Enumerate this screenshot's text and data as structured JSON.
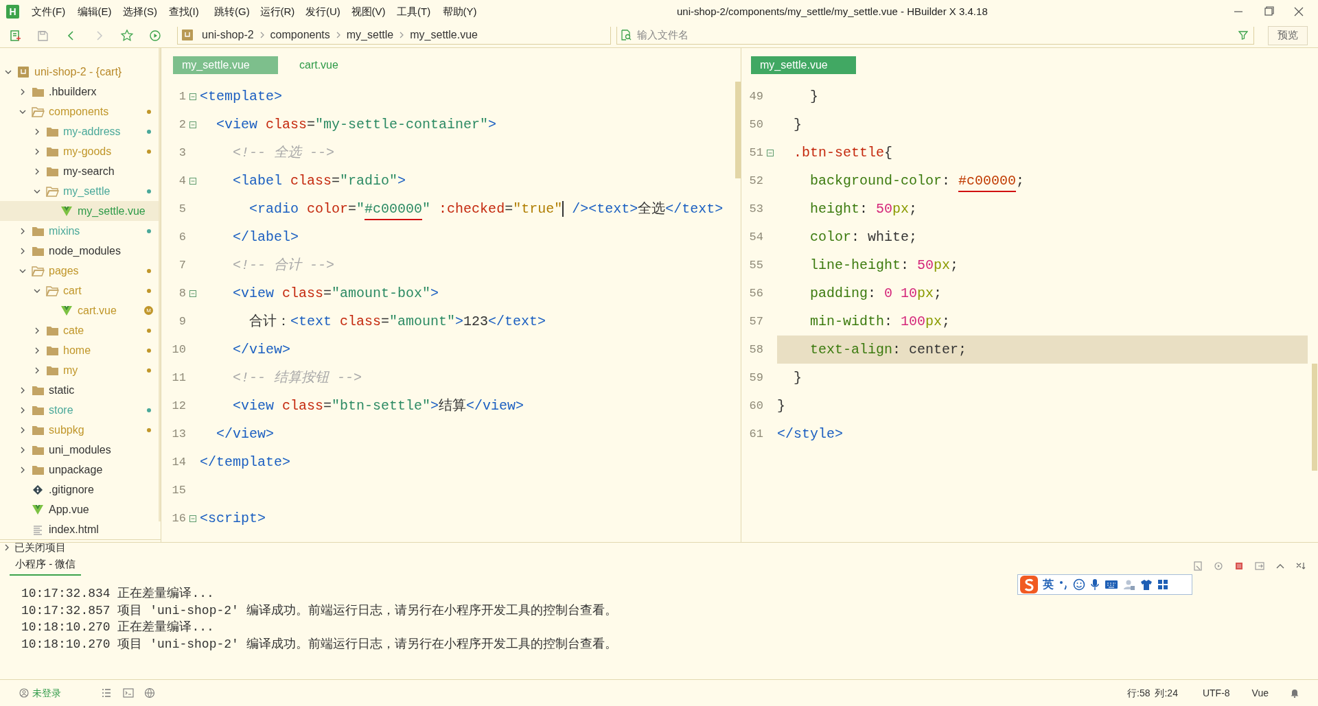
{
  "window": {
    "logo": "H",
    "title": "uni-shop-2/components/my_settle/my_settle.vue - HBuilder X 3.4.18"
  },
  "menu": [
    "文件(F)",
    "编辑(E)",
    "选择(S)",
    "查找(I)",
    "跳转(G)",
    "运行(R)",
    "发行(U)",
    "视图(V)",
    "工具(T)",
    "帮助(Y)"
  ],
  "toolbar": {
    "breadcrumb": [
      "uni-shop-2",
      "components",
      "my_settle",
      "my_settle.vue"
    ],
    "search": {
      "placeholder": "输入文件名"
    },
    "preview_button": "预览"
  },
  "sidebar": {
    "tree": [
      {
        "label": "uni-shop-2 - {cart}",
        "kind": "project",
        "expanded": true,
        "selected": false,
        "children": [
          {
            "label": ".hbuilderx",
            "kind": "folder",
            "expanded": false,
            "selected": false
          },
          {
            "label": "components",
            "kind": "folder",
            "expanded": true,
            "selected": false,
            "color": "#c0962a",
            "children": [
              {
                "label": "my-address",
                "kind": "folder",
                "expanded": false,
                "selected": false,
                "color": "#4aa89a"
              },
              {
                "label": "my-goods",
                "kind": "folder",
                "expanded": false,
                "selected": false,
                "color": "#c0962a"
              },
              {
                "label": "my-search",
                "kind": "folder",
                "expanded": false,
                "selected": false
              },
              {
                "label": "my_settle",
                "kind": "folder",
                "expanded": true,
                "selected": false,
                "color": "#4aa89a",
                "children": [
                  {
                    "label": "my_settle.vue",
                    "kind": "vue",
                    "selected": true
                  }
                ]
              }
            ]
          },
          {
            "label": "mixins",
            "kind": "folder",
            "expanded": false,
            "selected": false,
            "color": "#4aa89a"
          },
          {
            "label": "node_modules",
            "kind": "folder",
            "expanded": false,
            "selected": false
          },
          {
            "label": "pages",
            "kind": "folder",
            "expanded": true,
            "selected": false,
            "color": "#c0962a",
            "children": [
              {
                "label": "cart",
                "kind": "folder",
                "expanded": true,
                "selected": false,
                "color": "#c0962a",
                "children": [
                  {
                    "label": "cart.vue",
                    "kind": "vue",
                    "selected": false,
                    "color": "#c0962a",
                    "badge": "M"
                  }
                ]
              },
              {
                "label": "cate",
                "kind": "folder",
                "expanded": false,
                "selected": false,
                "color": "#c0962a"
              },
              {
                "label": "home",
                "kind": "folder",
                "expanded": false,
                "selected": false,
                "color": "#c0962a"
              },
              {
                "label": "my",
                "kind": "folder",
                "expanded": false,
                "selected": false,
                "color": "#c0962a"
              }
            ]
          },
          {
            "label": "static",
            "kind": "folder",
            "expanded": false,
            "selected": false
          },
          {
            "label": "store",
            "kind": "folder",
            "expanded": false,
            "selected": false,
            "color": "#4aa89a"
          },
          {
            "label": "subpkg",
            "kind": "folder",
            "expanded": false,
            "selected": false,
            "color": "#c0962a"
          },
          {
            "label": "uni_modules",
            "kind": "folder",
            "expanded": false,
            "selected": false
          },
          {
            "label": "unpackage",
            "kind": "folder",
            "expanded": false,
            "selected": false
          },
          {
            "label": ".gitignore",
            "kind": "git",
            "selected": false
          },
          {
            "label": "App.vue",
            "kind": "vue",
            "selected": false
          },
          {
            "label": "index.html",
            "kind": "file",
            "selected": false
          }
        ]
      }
    ],
    "closed_projects": "已关闭项目"
  },
  "editors": [
    {
      "tabs": [
        {
          "label": "my_settle.vue",
          "selected": true
        },
        {
          "label": "cart.vue",
          "selected": false
        }
      ],
      "lines": [
        {
          "n": "1",
          "fold": true,
          "current": false,
          "tokens": [
            {
              "tag": "<template>"
            }
          ]
        },
        {
          "n": "2",
          "fold": true,
          "current": false,
          "tokens": [
            {
              "tag": "  <view"
            },
            {
              "attr": " class"
            },
            {
              "txt": "="
            },
            {
              "str": "\"my-settle-container\""
            },
            {
              "tag": ">"
            }
          ]
        },
        {
          "n": "3",
          "fold": false,
          "current": false,
          "tokens": [
            {
              "cmt": "    <!-- 全选 -->"
            }
          ]
        },
        {
          "n": "4",
          "fold": true,
          "current": false,
          "tokens": [
            {
              "tag": "    <label"
            },
            {
              "attr": " class"
            },
            {
              "txt": "="
            },
            {
              "str": "\"radio\""
            },
            {
              "tag": ">"
            }
          ]
        },
        {
          "n": "5",
          "fold": false,
          "current": false,
          "tokens": [
            {
              "tag": "      <radio"
            },
            {
              "attr": " color"
            },
            {
              "txt": "="
            },
            {
              "str": "\""
            },
            {
              "str": "#c00000",
              "underline": true
            },
            {
              "str": "\""
            },
            {
              "attr": " :checked"
            },
            {
              "txt": "="
            },
            {
              "kw": "\"true\"",
              "caret": true
            },
            {
              "tag": " /><text>"
            },
            {
              "txt": "全选"
            },
            {
              "tag": "</text>"
            }
          ]
        },
        {
          "n": "6",
          "fold": false,
          "current": false,
          "tokens": [
            {
              "tag": "    </label>"
            }
          ]
        },
        {
          "n": "7",
          "fold": false,
          "current": false,
          "tokens": [
            {
              "cmt": "    <!-- 合计 -->"
            }
          ]
        },
        {
          "n": "8",
          "fold": true,
          "current": false,
          "tokens": [
            {
              "tag": "    <view"
            },
            {
              "attr": " class"
            },
            {
              "txt": "="
            },
            {
              "str": "\"amount-box\""
            },
            {
              "tag": ">"
            }
          ]
        },
        {
          "n": "9",
          "fold": false,
          "current": false,
          "tokens": [
            {
              "txt": "      合计："
            },
            {
              "tag": "<text"
            },
            {
              "attr": " class"
            },
            {
              "txt": "="
            },
            {
              "str": "\"amount\""
            },
            {
              "tag": ">"
            },
            {
              "txt": "123"
            },
            {
              "tag": "</text>"
            }
          ]
        },
        {
          "n": "10",
          "fold": false,
          "current": false,
          "tokens": [
            {
              "tag": "    </view>"
            }
          ]
        },
        {
          "n": "11",
          "fold": false,
          "current": false,
          "tokens": [
            {
              "cmt": "    <!-- 结算按钮 -->"
            }
          ]
        },
        {
          "n": "12",
          "fold": false,
          "current": false,
          "tokens": [
            {
              "tag": "    <view"
            },
            {
              "attr": " class"
            },
            {
              "txt": "="
            },
            {
              "str": "\"btn-settle\""
            },
            {
              "tag": ">"
            },
            {
              "txt": "结算"
            },
            {
              "tag": "</view>"
            }
          ]
        },
        {
          "n": "13",
          "fold": false,
          "current": false,
          "tokens": [
            {
              "tag": "  </view>"
            }
          ]
        },
        {
          "n": "14",
          "fold": false,
          "current": false,
          "tokens": [
            {
              "tag": "</template>"
            }
          ]
        },
        {
          "n": "15",
          "fold": false,
          "current": false
        },
        {
          "n": "16",
          "fold": true,
          "current": false,
          "tokens": [
            {
              "tag": "<script>"
            }
          ]
        }
      ]
    },
    {
      "tabs": [
        {
          "label": "my_settle.vue",
          "selected": true
        }
      ],
      "lines": [
        {
          "n": "49",
          "fold": false,
          "current": false,
          "tokens": [
            {
              "txt": "    }"
            }
          ]
        },
        {
          "n": "50",
          "fold": false,
          "current": false,
          "tokens": [
            {
              "txt": "  }"
            }
          ]
        },
        {
          "n": "51",
          "fold": true,
          "current": false,
          "tokens": [
            {
              "sel": "  .btn-settle"
            },
            {
              "txt": "{"
            }
          ]
        },
        {
          "n": "52",
          "fold": false,
          "current": false,
          "tokens": [
            {
              "prop": "    background-color"
            },
            {
              "txt": ": "
            },
            {
              "hex": "#c00000",
              "underline": true
            },
            {
              "txt": ";"
            }
          ]
        },
        {
          "n": "53",
          "fold": false,
          "current": false,
          "tokens": [
            {
              "prop": "    height"
            },
            {
              "txt": ": "
            },
            {
              "num": "50"
            },
            {
              "unit": "px"
            },
            {
              "txt": ";"
            }
          ]
        },
        {
          "n": "54",
          "fold": false,
          "current": false,
          "tokens": [
            {
              "prop": "    color"
            },
            {
              "txt": ": white;"
            }
          ]
        },
        {
          "n": "55",
          "fold": false,
          "current": false,
          "tokens": [
            {
              "prop": "    line-height"
            },
            {
              "txt": ": "
            },
            {
              "num": "50"
            },
            {
              "unit": "px"
            },
            {
              "txt": ";"
            }
          ]
        },
        {
          "n": "56",
          "fold": false,
          "current": false,
          "tokens": [
            {
              "prop": "    padding"
            },
            {
              "txt": ": "
            },
            {
              "num": "0 10"
            },
            {
              "unit": "px"
            },
            {
              "txt": ";"
            }
          ]
        },
        {
          "n": "57",
          "fold": false,
          "current": false,
          "tokens": [
            {
              "prop": "    min-width"
            },
            {
              "txt": ": "
            },
            {
              "num": "100"
            },
            {
              "unit": "px"
            },
            {
              "txt": ";"
            }
          ]
        },
        {
          "n": "58",
          "fold": false,
          "current": true,
          "tokens": [
            {
              "prop": "    text-align"
            },
            {
              "txt": ": center;"
            }
          ]
        },
        {
          "n": "59",
          "fold": false,
          "current": false,
          "tokens": [
            {
              "txt": "  }"
            }
          ]
        },
        {
          "n": "60",
          "fold": false,
          "current": false,
          "tokens": [
            {
              "txt": "}"
            }
          ]
        },
        {
          "n": "61",
          "fold": false,
          "current": false,
          "tokens": [
            {
              "tag": "</style>"
            }
          ]
        }
      ]
    }
  ],
  "console": {
    "tab": "小程序 - 微信",
    "lines": [
      "10:17:32.834 正在差量编译...",
      "10:17:32.857 项目 'uni-shop-2' 编译成功。前端运行日志，请另行在小程序开发工具的控制台查看。",
      "10:18:10.270 正在差量编译...",
      "10:18:10.270 项目 'uni-shop-2' 编译成功。前端运行日志，请另行在小程序开发工具的控制台查看。"
    ]
  },
  "ime_toolbar": {
    "language": "英"
  },
  "status_bar": {
    "login": "未登录",
    "line": "行:58",
    "column": "列:24",
    "encoding": "UTF-8",
    "language": "Vue"
  }
}
